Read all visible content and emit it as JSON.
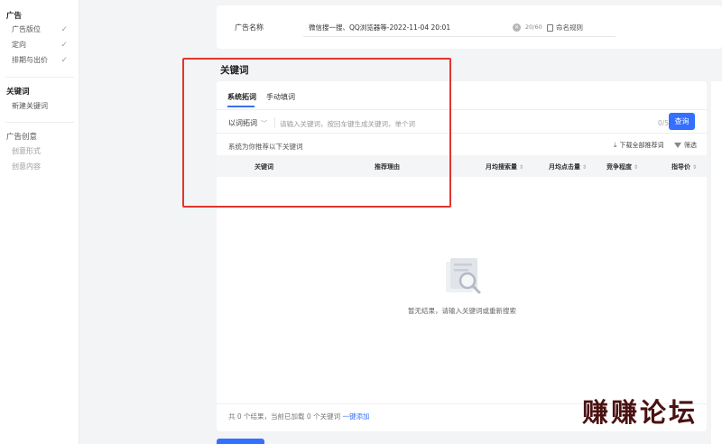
{
  "sidebar": {
    "sections": [
      {
        "title": "广告",
        "items": [
          {
            "label": "广告版位",
            "checked": true
          },
          {
            "label": "定向",
            "checked": true
          },
          {
            "label": "排期与出价",
            "checked": true
          }
        ]
      },
      {
        "title": "关键词",
        "items": [
          {
            "label": "新建关键词",
            "checked": false
          }
        ]
      },
      {
        "title": "广告创意",
        "items": [
          {
            "label": "创意形式",
            "checked": false
          },
          {
            "label": "创意内容",
            "checked": false
          }
        ]
      }
    ]
  },
  "ad_name": {
    "label": "广告名称",
    "value": "微信搜一搜、QQ浏览器等-2022-11-04 20:01",
    "count": "20/60",
    "rule_label": "命名规则"
  },
  "keywords": {
    "title": "关键词",
    "tabs": [
      "系统拓词",
      "手动填词"
    ],
    "active_tab": 0,
    "mode": "以词拓词",
    "input_placeholder": "请输入关键词，按回车键生成关键词，单个词",
    "input_count": "0/5",
    "query_label": "查询",
    "recommend_label": "系统为你推荐以下关键词",
    "download_label": "下载全部推荐词",
    "filter_label": "筛选",
    "columns": [
      "关键词",
      "推荐理由",
      "月均搜索量",
      "月均点击量",
      "竞争程度",
      "指导价"
    ],
    "empty_text": "暂无结果，请输入关键词或重新搜索",
    "footer_text": "共 0 个结果，当前已加载 0 个关键词",
    "footer_link": "一键添加"
  },
  "watermark": "赚赚论坛",
  "colors": {
    "accent": "#3370ff",
    "highlight": "#e0362d"
  }
}
